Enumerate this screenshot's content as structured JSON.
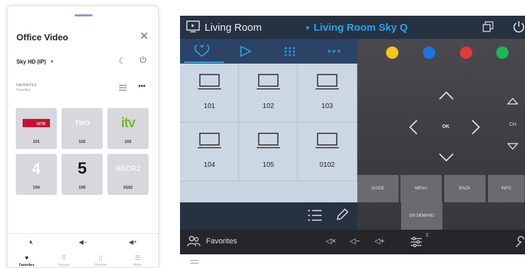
{
  "phone": {
    "title": "Office Video",
    "close_icon": "close-icon",
    "source": "Sky HD (IP)",
    "favorites_label": "FAVORITES",
    "favorites_sub": "Favorites",
    "more_label": "•••",
    "channels": [
      {
        "logo": "one",
        "number": "101"
      },
      {
        "logo": "TWO",
        "number": "102"
      },
      {
        "logo": "itv",
        "number": "103"
      },
      {
        "logo": "4",
        "number": "104"
      },
      {
        "logo": "5",
        "number": "105"
      },
      {
        "logo": "BBCR2",
        "number": "0102"
      }
    ],
    "nav": [
      {
        "label": "Favorites",
        "icon": "heart-icon"
      },
      {
        "label": "Keypad",
        "icon": "keypad-icon"
      },
      {
        "label": "Remote",
        "icon": "remote-icon"
      },
      {
        "label": "More",
        "icon": "more-icon"
      }
    ]
  },
  "remote": {
    "room": "Living Room",
    "source": "Living Room Sky Q",
    "colors": [
      "#f5c518",
      "#1a73e8",
      "#e53935",
      "#1db954"
    ],
    "tiles": [
      "101",
      "102",
      "103",
      "104",
      "105",
      "0102"
    ],
    "ok": "OK",
    "ch": "CH",
    "functions": [
      "GUIDE",
      "MENU",
      "BACK",
      "INFO"
    ],
    "on_demand": "ON DEMAND",
    "favorites": "Favorites",
    "eq_badge": "2"
  }
}
